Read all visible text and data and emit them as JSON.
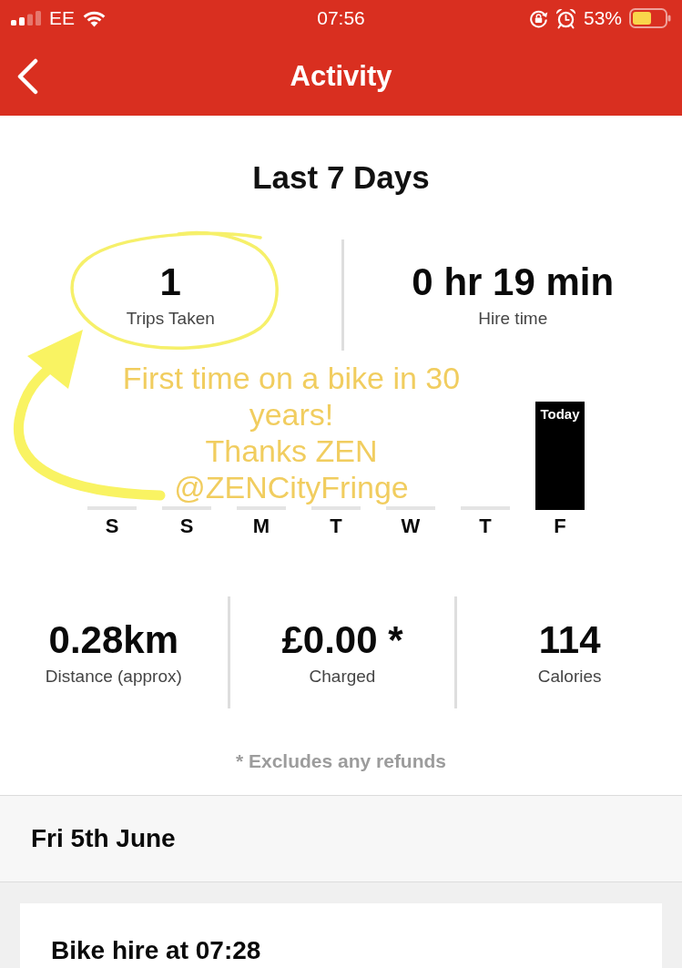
{
  "status_bar": {
    "carrier": "EE",
    "time": "07:56",
    "battery": "53%"
  },
  "nav_bar": {
    "title": "Activity"
  },
  "summary": {
    "title": "Last 7 Days",
    "top_stats": [
      {
        "value": "1",
        "label": "Trips Taken"
      },
      {
        "value": "0 hr 19 min",
        "label": "Hire time"
      }
    ],
    "days": [
      {
        "label": "S",
        "kind": "empty"
      },
      {
        "label": "S",
        "kind": "empty"
      },
      {
        "label": "M",
        "kind": "empty"
      },
      {
        "label": "T",
        "kind": "empty"
      },
      {
        "label": "W",
        "kind": "empty"
      },
      {
        "label": "T",
        "kind": "empty"
      },
      {
        "label": "F",
        "kind": "filled",
        "bar_label": "Today"
      }
    ],
    "bottom_stats": [
      {
        "value": "0.28km",
        "label": "Distance (approx)"
      },
      {
        "value": "£0.00 *",
        "label": "Charged"
      },
      {
        "value": "114",
        "label": "Calories"
      }
    ],
    "footnote": "* Excludes any refunds"
  },
  "annotation": {
    "lines": [
      "First time on a bike in 30",
      "years!",
      "Thanks ZEN",
      "@ZENCityFringe"
    ]
  },
  "history": {
    "date": "Fri 5th June",
    "trips": [
      {
        "title": "Bike hire at 07:28"
      }
    ]
  }
}
